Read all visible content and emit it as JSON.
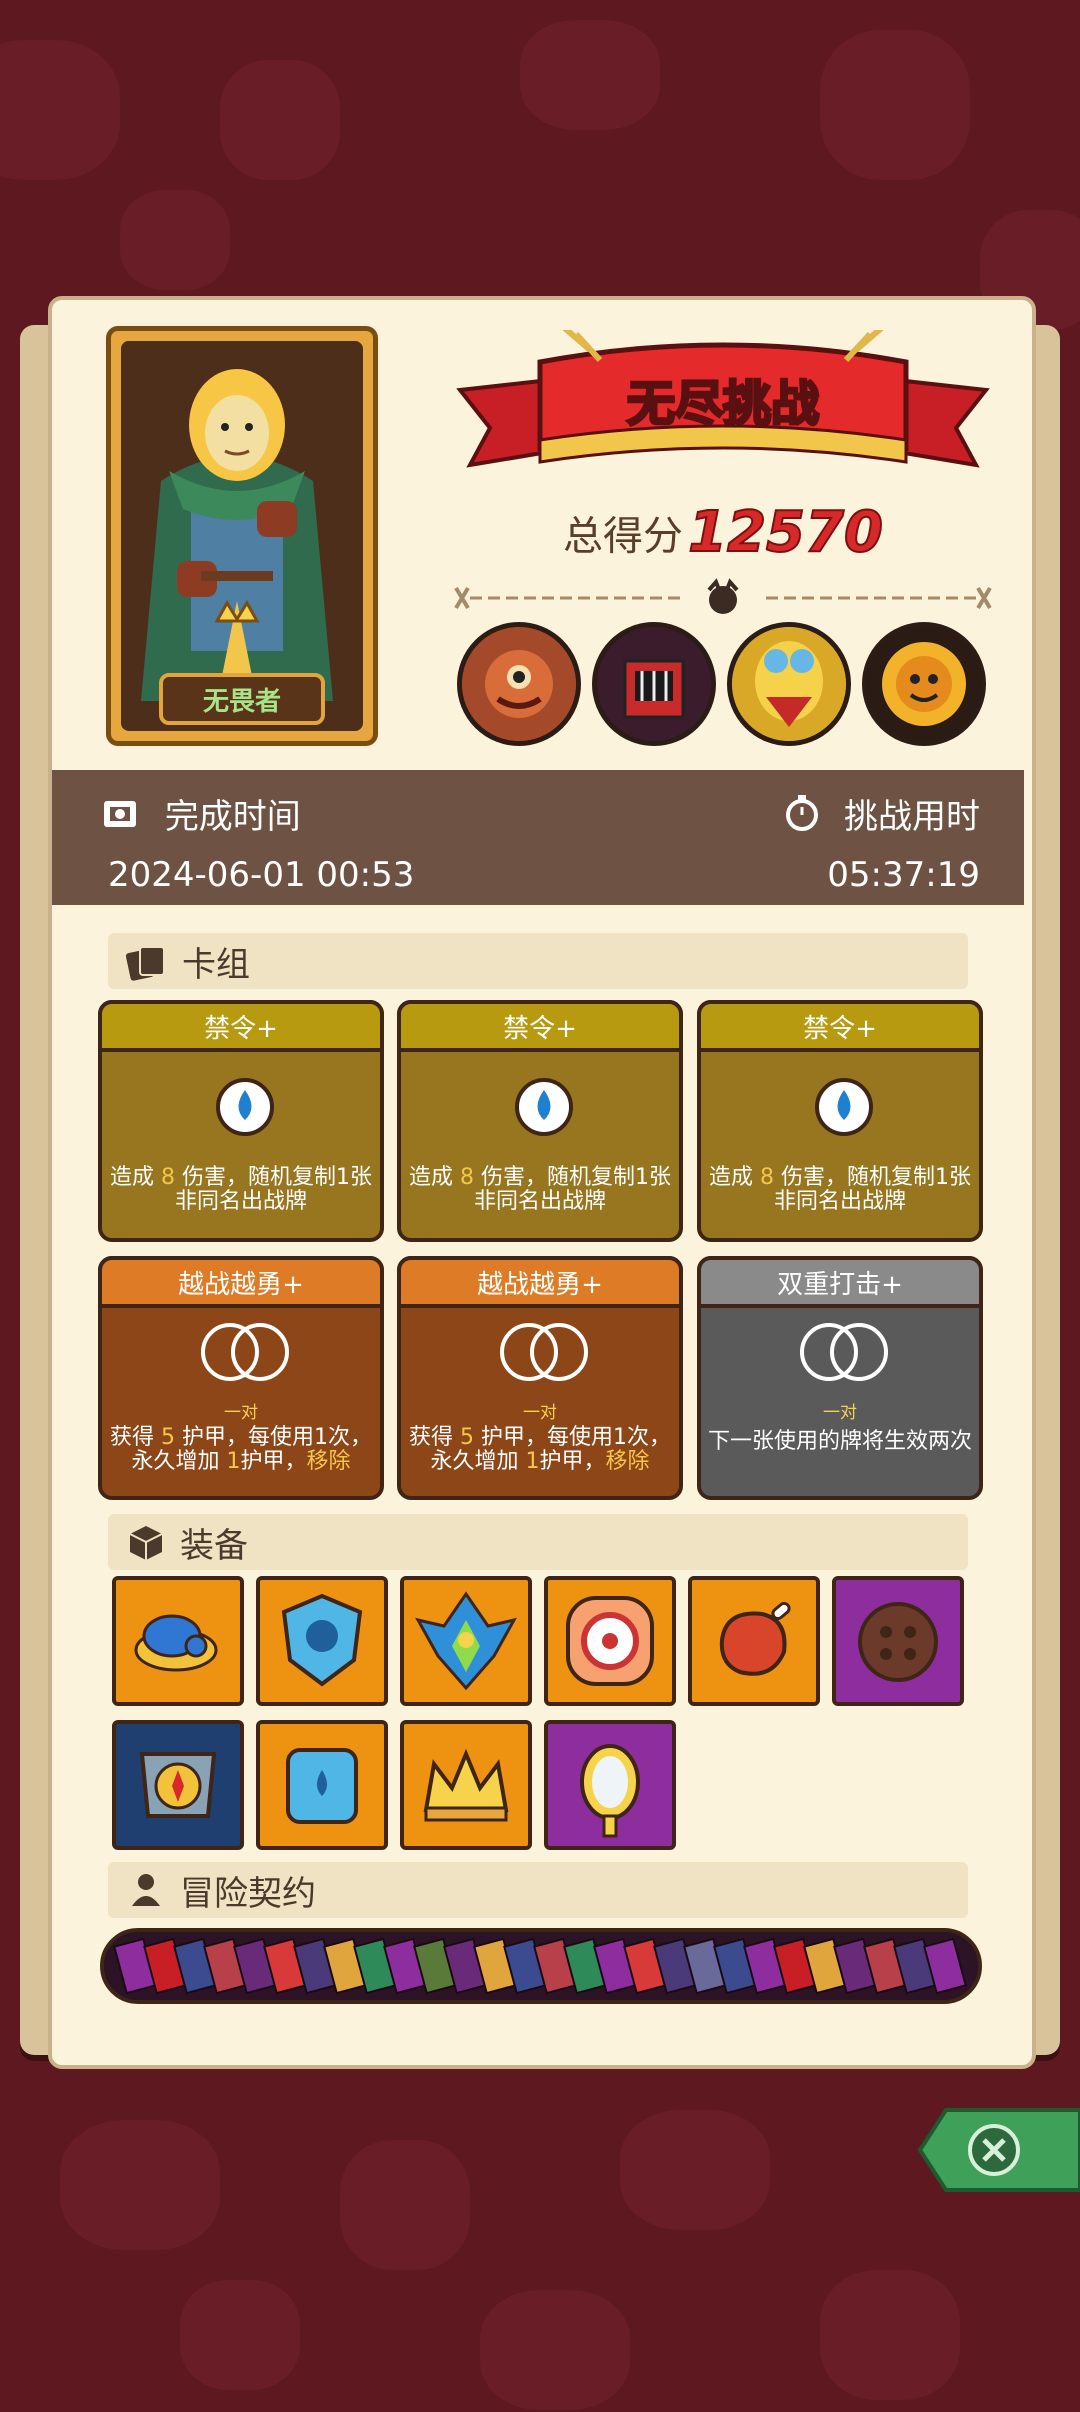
{
  "hero": {
    "name": "无畏者"
  },
  "banner": {
    "title": "无尽挑战"
  },
  "score": {
    "label": "总得分",
    "value": "12570"
  },
  "bosses": [
    "boss-eye-blob",
    "boss-red-robot",
    "boss-skull-mask",
    "boss-sun-pumpkin"
  ],
  "times": {
    "complete_label": "完成时间",
    "complete_value": "2024-06-01 00:53",
    "duration_label": "挑战用时",
    "duration_value": "05:37:19"
  },
  "deck": {
    "title": "卡组",
    "cards": [
      {
        "name": "禁令+",
        "desc_pre": "造成 ",
        "num": "8",
        "desc_post": " 伤害，随机复制1张非同名出战牌",
        "style": "gold"
      },
      {
        "name": "禁令+",
        "desc_pre": "造成 ",
        "num": "8",
        "desc_post": " 伤害，随机复制1张非同名出战牌",
        "style": "gold"
      },
      {
        "name": "禁令+",
        "desc_pre": "造成 ",
        "num": "8",
        "desc_post": " 伤害，随机复制1张非同名出战牌",
        "style": "gold"
      },
      {
        "name": "越战越勇+",
        "tag": "一对",
        "desc_a": "获得 ",
        "num_a": "5",
        "desc_b": " 护甲，每使用1次，永久增加 ",
        "num_b": "1",
        "desc_c": "护甲，",
        "hl": "移除",
        "style": "brown"
      },
      {
        "name": "越战越勇+",
        "tag": "一对",
        "desc_a": "获得 ",
        "num_a": "5",
        "desc_b": " 护甲，每使用1次，永久增加 ",
        "num_b": "1",
        "desc_c": "护甲，",
        "hl": "移除",
        "style": "brown"
      },
      {
        "name": "双重打击+",
        "tag": "一对",
        "desc": "下一张使用的牌将生效两次",
        "style": "grey"
      }
    ]
  },
  "equipment": {
    "title": "装备",
    "items": [
      {
        "icon": "blue-slime-icon",
        "color": "orange"
      },
      {
        "icon": "ice-shield-icon",
        "color": "orange"
      },
      {
        "icon": "flame-crystal-icon",
        "color": "orange"
      },
      {
        "icon": "gear-coin-icon",
        "color": "orange"
      },
      {
        "icon": "ham-meat-icon",
        "color": "orange"
      },
      {
        "icon": "button-icon",
        "color": "purple"
      },
      {
        "icon": "compass-armor-icon",
        "color": "blue"
      },
      {
        "icon": "water-cube-icon",
        "color": "orange"
      },
      {
        "icon": "crown-icon",
        "color": "orange"
      },
      {
        "icon": "magic-mirror-icon",
        "color": "purple"
      }
    ]
  },
  "contract": {
    "title": "冒险契约"
  },
  "colors": {
    "panel": "#fbf3dc",
    "score": "#d8292a",
    "timebar": "#6e5243",
    "close": "#3fa05a"
  }
}
